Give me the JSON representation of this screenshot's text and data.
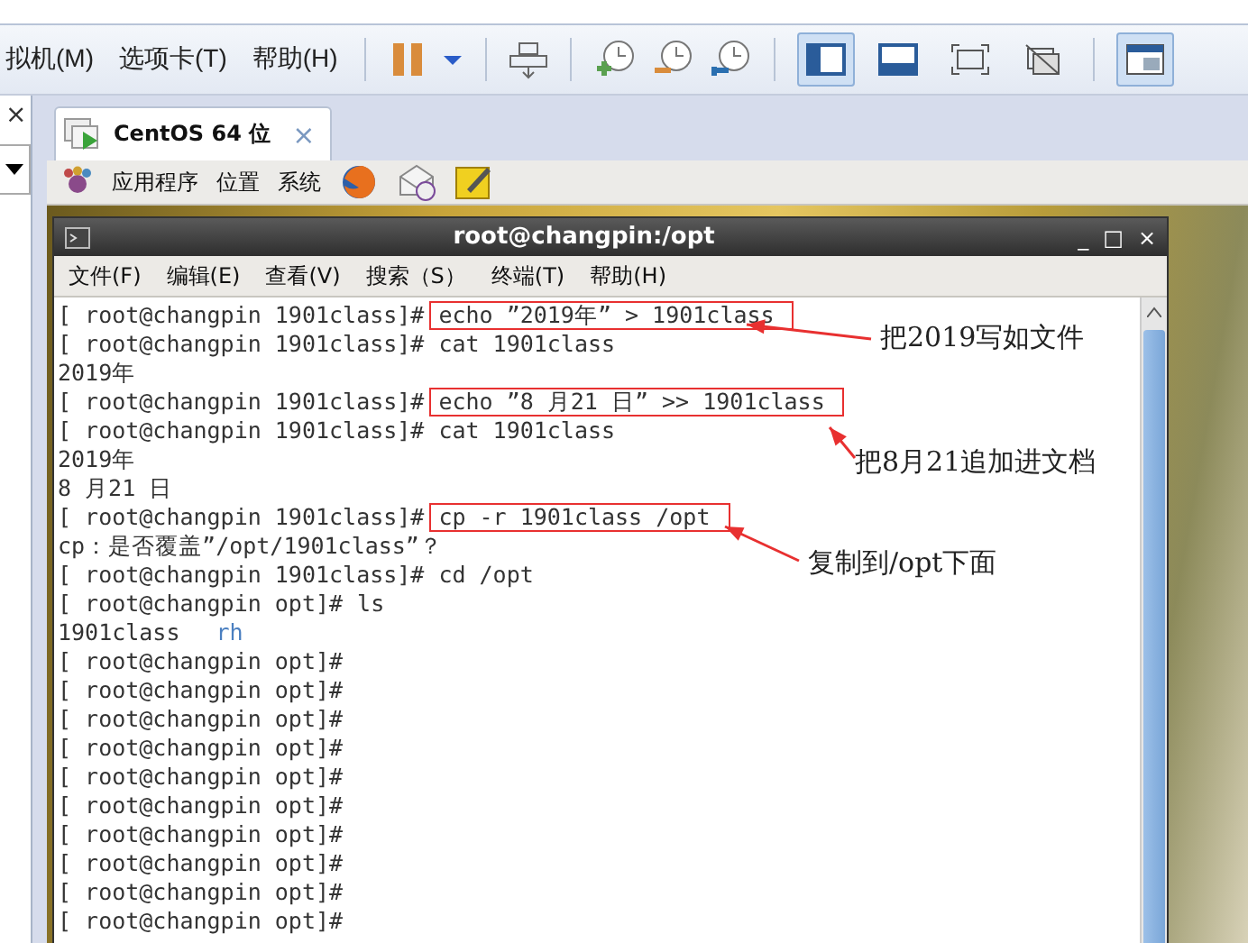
{
  "menu_bar": {
    "items": [
      "拟机(M)",
      "选项卡(T)",
      "帮助(H)"
    ]
  },
  "toolbar": {
    "view_buttons": [
      {
        "selected": true
      },
      {
        "selected": false
      },
      {
        "selected": false
      },
      {
        "selected": false
      }
    ],
    "library_button": {
      "selected": true
    }
  },
  "left_panel": {
    "close_label": "×"
  },
  "vm_tab": {
    "label": "CentOS 64 位",
    "close_label": "×",
    "selected": true
  },
  "guest_panel": {
    "menus": [
      "应用程序",
      "位置",
      "系统"
    ]
  },
  "terminal": {
    "title": "root@changpin:/opt",
    "controls": [
      "_",
      "□",
      "×"
    ],
    "menus": [
      "文件(F)",
      "编辑(E)",
      "查看(V)",
      "搜索（S）",
      "终端(T)",
      "帮助(H)"
    ],
    "lines": [
      {
        "kind": "prompt",
        "prompt": "[ root@changpin 1901class]#",
        "command": "echo ”2019年” > 1901class",
        "boxed": true
      },
      {
        "kind": "prompt",
        "prompt": "[ root@changpin 1901class]#",
        "command": "cat 1901class",
        "boxed": false
      },
      {
        "kind": "output",
        "text": "2019年"
      },
      {
        "kind": "prompt",
        "prompt": "[ root@changpin 1901class]#",
        "command": "echo ”8 月21 日” >> 1901class",
        "boxed": true
      },
      {
        "kind": "prompt",
        "prompt": "[ root@changpin 1901class]#",
        "command": "cat 1901class",
        "boxed": false
      },
      {
        "kind": "output",
        "text": "2019年"
      },
      {
        "kind": "output",
        "text": "8 月21 日"
      },
      {
        "kind": "prompt",
        "prompt": "[ root@changpin 1901class]#",
        "command": "cp -r 1901class /opt",
        "boxed": true
      },
      {
        "kind": "output",
        "text": "cp：是否覆盖”/opt/1901class”？"
      },
      {
        "kind": "prompt",
        "prompt": "[ root@changpin 1901class]#",
        "command": "cd /opt",
        "boxed": false
      },
      {
        "kind": "prompt",
        "prompt": "[ root@changpin opt]#",
        "command": "ls",
        "boxed": false
      },
      {
        "kind": "listing",
        "entries": [
          {
            "name": "1901class",
            "color": "#333333"
          },
          {
            "name": "rh",
            "color": "#4a7fc0"
          }
        ]
      },
      {
        "kind": "prompt",
        "prompt": "[ root@changpin opt]#"
      },
      {
        "kind": "prompt",
        "prompt": "[ root@changpin opt]#"
      },
      {
        "kind": "prompt",
        "prompt": "[ root@changpin opt]#"
      },
      {
        "kind": "prompt",
        "prompt": "[ root@changpin opt]#"
      },
      {
        "kind": "prompt",
        "prompt": "[ root@changpin opt]#"
      },
      {
        "kind": "prompt",
        "prompt": "[ root@changpin opt]#"
      },
      {
        "kind": "prompt",
        "prompt": "[ root@changpin opt]#"
      },
      {
        "kind": "prompt",
        "prompt": "[ root@changpin opt]#"
      },
      {
        "kind": "prompt",
        "prompt": "[ root@changpin opt]#"
      },
      {
        "kind": "prompt",
        "prompt": "[ root@changpin opt]#"
      }
    ]
  },
  "annotations": [
    "把2019写如文件",
    "把8月21追加进文档",
    "复制到/opt下面"
  ]
}
